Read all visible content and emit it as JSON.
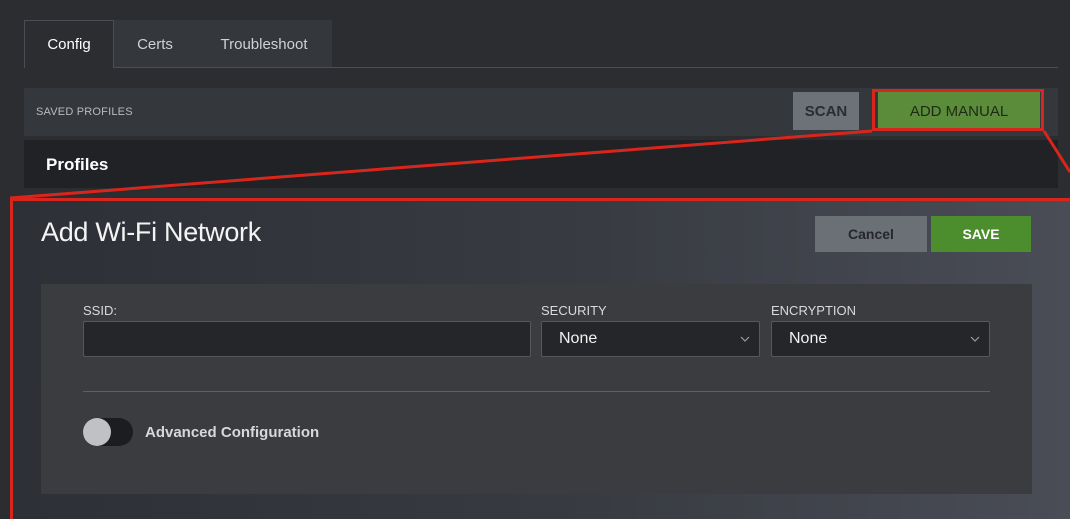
{
  "tabs": [
    {
      "label": "Config",
      "active": true
    },
    {
      "label": "Certs",
      "active": false
    },
    {
      "label": "Troubleshoot",
      "active": false
    }
  ],
  "saved_profiles": {
    "label": "SAVED PROFILES",
    "scan_label": "SCAN",
    "add_manual_label": "ADD MANUAL"
  },
  "profiles": {
    "title": "Profiles"
  },
  "modal": {
    "title": "Add Wi-Fi Network",
    "cancel_label": "Cancel",
    "save_label": "SAVE",
    "ssid": {
      "label": "SSID:",
      "value": "",
      "placeholder": ""
    },
    "security": {
      "label": "SECURITY",
      "selected": "None"
    },
    "encryption": {
      "label": "ENCRYPTION",
      "selected": "None"
    },
    "advanced": {
      "label": "Advanced Configuration",
      "enabled": false
    }
  },
  "icons": {
    "select_chevron": "chevron-down-icon"
  },
  "colors": {
    "highlight": "#d9261c",
    "accent_green": "#4c8d2e",
    "add_manual_green": "#5a8c3a"
  }
}
